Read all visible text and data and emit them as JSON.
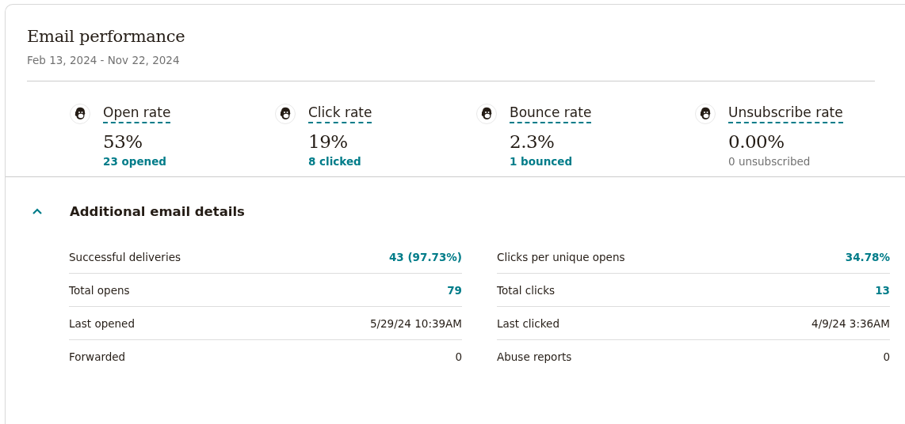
{
  "card": {
    "title": "Email performance",
    "date_range": "Feb 13, 2024 - Nov 22, 2024"
  },
  "metrics": [
    {
      "label": "Open rate",
      "value": "53%",
      "detail": "23 opened",
      "linked": true
    },
    {
      "label": "Click rate",
      "value": "19%",
      "detail": "8 clicked",
      "linked": true
    },
    {
      "label": "Bounce rate",
      "value": "2.3%",
      "detail": "1 bounced",
      "linked": true
    },
    {
      "label": "Unsubscribe rate",
      "value": "0.00%",
      "detail": "0 unsubscribed",
      "linked": false
    }
  ],
  "details": {
    "title": "Additional email details",
    "expanded": true,
    "columns": [
      [
        {
          "label": "Successful deliveries",
          "value": "43 (97.73%)",
          "linked": true
        },
        {
          "label": "Total opens",
          "value": "79",
          "linked": true
        },
        {
          "label": "Last opened",
          "value": "5/29/24 10:39AM",
          "linked": false
        },
        {
          "label": "Forwarded",
          "value": "0",
          "linked": false
        }
      ],
      [
        {
          "label": "Clicks per unique opens",
          "value": "34.78%",
          "linked": true
        },
        {
          "label": "Total clicks",
          "value": "13",
          "linked": true
        },
        {
          "label": "Last clicked",
          "value": "4/9/24 3:36AM",
          "linked": false
        },
        {
          "label": "Abuse reports",
          "value": "0",
          "linked": false
        }
      ]
    ]
  }
}
